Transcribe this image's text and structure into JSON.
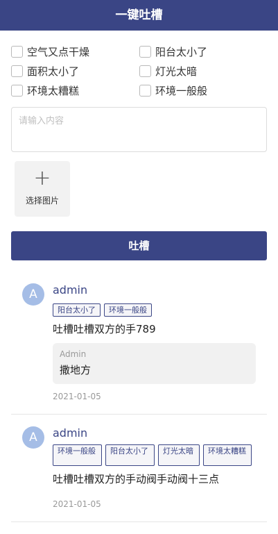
{
  "header": {
    "title": "一键吐槽"
  },
  "options": [
    {
      "label": "空气又点干燥",
      "checked": false
    },
    {
      "label": "阳台太小了",
      "checked": false
    },
    {
      "label": "面积太小了",
      "checked": false
    },
    {
      "label": "灯光太暗",
      "checked": false
    },
    {
      "label": "环境太糟糕",
      "checked": false
    },
    {
      "label": "环境一般般",
      "checked": false
    }
  ],
  "input": {
    "placeholder": "请输入内容",
    "value": ""
  },
  "upload": {
    "icon": "plus-icon",
    "label": "选择图片"
  },
  "submit": {
    "label": "吐槽"
  },
  "posts": [
    {
      "avatar": "A",
      "user": "admin",
      "tags": [
        "阳台太小了",
        "环境一般般"
      ],
      "content": "吐槽吐槽双方的手789",
      "reply": {
        "name": "Admin",
        "text": "撒地方"
      },
      "date": "2021-01-05"
    },
    {
      "avatar": "A",
      "user": "admin",
      "tags": [
        "环境一般般",
        "阳台太小了",
        "灯光太暗",
        "环境太糟糕"
      ],
      "content": "吐槽吐槽双方的手动阀手动阀十三点",
      "date": "2021-01-05"
    }
  ],
  "colors": {
    "primary": "#3a4585",
    "avatar": "#a5bde6",
    "reply_bg": "#f1f1f1"
  }
}
